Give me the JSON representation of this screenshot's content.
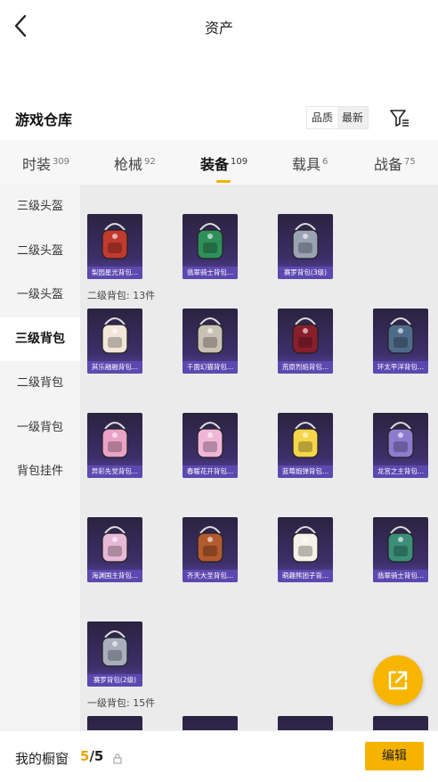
{
  "header": {
    "title": "资产"
  },
  "warehouse": {
    "title": "游戏仓库",
    "sort_quality": "品质",
    "sort_latest": "最新"
  },
  "tabs": [
    {
      "label": "时装",
      "count": "309"
    },
    {
      "label": "枪械",
      "count": "92"
    },
    {
      "label": "装备",
      "count": "109"
    },
    {
      "label": "载具",
      "count": "6"
    },
    {
      "label": "战备",
      "count": "75"
    }
  ],
  "sidebar": [
    {
      "label": "三级头盔"
    },
    {
      "label": "二级头盔"
    },
    {
      "label": "一级头盔"
    },
    {
      "label": "三级背包"
    },
    {
      "label": "二级背包"
    },
    {
      "label": "一级背包"
    },
    {
      "label": "背包挂件"
    }
  ],
  "groups": {
    "lvl2": "二级背包: 13件",
    "lvl1": "一级背包: 15件"
  },
  "items": [
    {
      "name": "梨园星光背包...",
      "color": "#c23a2e"
    },
    {
      "name": "翡翠骑士背包...",
      "color": "#2f8f5a"
    },
    {
      "name": "赛罗背包(3级)",
      "color": "#9aa3b4"
    },
    {
      "name": "其乐融融背包...",
      "color": "#f2e6d8"
    },
    {
      "name": "千面幻猫背包...",
      "color": "#c9c1b3"
    },
    {
      "name": "荒原烈焰背包...",
      "color": "#8a1f2c"
    },
    {
      "name": "环太平洋背包...",
      "color": "#4f6b8a"
    },
    {
      "name": "异彩先觉背包...",
      "color": "#e8a3c6"
    },
    {
      "name": "春暖花开背包...",
      "color": "#f0b6d8"
    },
    {
      "name": "蓝莓炮弹背包...",
      "color": "#f5d64a"
    },
    {
      "name": "龙宫之主背包...",
      "color": "#8e7bd0"
    },
    {
      "name": "海渊国主背包...",
      "color": "#e7b7d6"
    },
    {
      "name": "齐天大圣背包...",
      "color": "#b35a2e"
    },
    {
      "name": "萌趣熊团子背...",
      "color": "#f4f1e8"
    },
    {
      "name": "翡翠骑士背包...",
      "color": "#3b8f78"
    },
    {
      "name": "赛罗背包(2级)",
      "color": "#a8aebc"
    }
  ],
  "bottom": {
    "label": "我的橱窗",
    "current": "5",
    "total": "/5",
    "edit": "编辑"
  },
  "colors": {
    "accent": "#f5b300",
    "card_bar": "#5c49b0"
  }
}
